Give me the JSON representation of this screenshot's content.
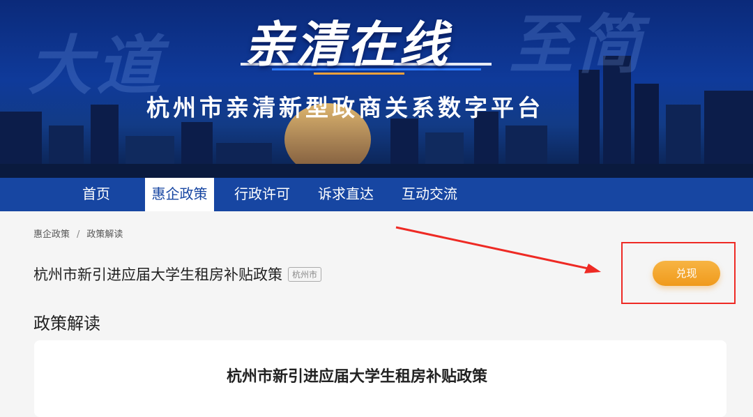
{
  "banner": {
    "logo": "亲清在线",
    "subtitle": "杭州市亲清新型政商关系数字平台",
    "bg_left": "大道",
    "bg_right": "至简"
  },
  "nav": {
    "items": [
      {
        "label": "首页"
      },
      {
        "label": "惠企政策"
      },
      {
        "label": "行政许可"
      },
      {
        "label": "诉求直达"
      },
      {
        "label": "互动交流"
      }
    ],
    "active": "惠企政策"
  },
  "breadcrumb": {
    "level1": "惠企政策",
    "separator": "/",
    "level2": "政策解读"
  },
  "policy": {
    "title": "杭州市新引进应届大学生租房补贴政策",
    "region": "杭州市",
    "redeem_label": "兑现"
  },
  "section": {
    "title": "政策解读"
  },
  "card": {
    "title": "杭州市新引进应届大学生租房补贴政策"
  },
  "colors": {
    "nav_bg": "#1746a2",
    "button_orange": "#f09a1c",
    "annotation_red": "#ee2a24"
  }
}
